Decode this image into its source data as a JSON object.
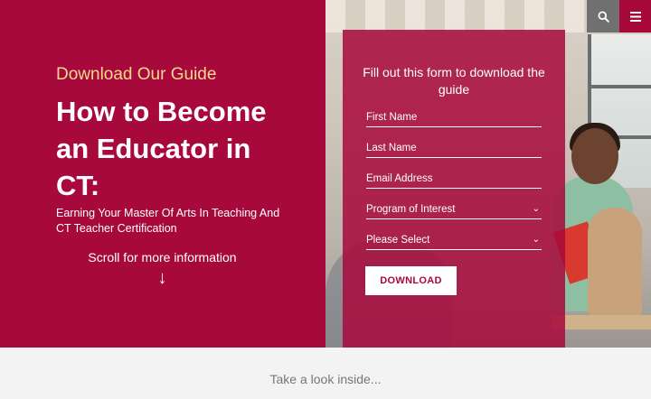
{
  "hero": {
    "eyebrow": "Download Our Guide",
    "title": "How to Become an Educator in CT:",
    "subtitle": "Earning Your Master Of Arts In Teaching And CT Teacher Certification",
    "scroll_text": "Scroll for more information",
    "scroll_arrow": "↓"
  },
  "form": {
    "heading": "Fill out this form to download the guide",
    "fields": {
      "first_name": "First Name",
      "last_name": "Last Name",
      "email": "Email Address",
      "program": "Program of Interest",
      "please_select": "Please Select"
    },
    "download_label": "DOWNLOAD"
  },
  "header": {
    "search_icon": "search-icon",
    "menu_icon": "menu-icon"
  },
  "section": {
    "take_a_look": "Take a look inside..."
  },
  "colors": {
    "brand": "#a8093c",
    "accent": "#f6d98a",
    "search_bg": "#707070",
    "page_bg": "#f3f3f3"
  }
}
